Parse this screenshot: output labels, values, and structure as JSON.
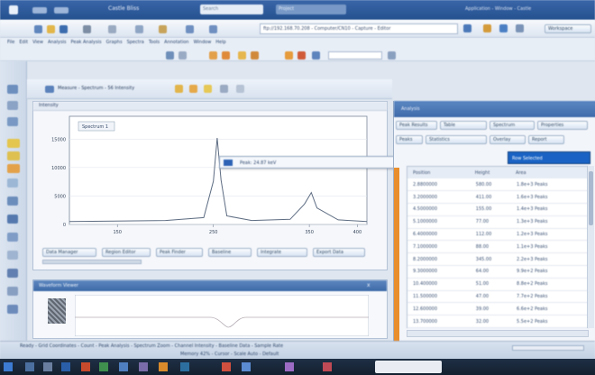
{
  "titlebar": {
    "title": "Castle Bliss",
    "search_placeholder": "Search",
    "extra": "Project",
    "right_text": "Application - Window - Castle"
  },
  "toolbar": {
    "address": "ftp://192.168.70.208 - Computer/CN10 - Capture - Editor",
    "right_button": "Workspace"
  },
  "menu": {
    "items": [
      "File",
      "Edit",
      "View",
      "Analysis",
      "Peak Analysis",
      "Graphs",
      "Spectra",
      "Tools",
      "Annotation",
      "Window",
      "Help"
    ]
  },
  "document": {
    "title": "Measure - Spectrum - 56 Intensity"
  },
  "plot": {
    "panel_title": "Intensity",
    "legend": "Spectrum 1",
    "popup_text": "Peak: 24.87 keV",
    "controls": [
      "Data Manager",
      "Region Editor",
      "Peak Finder",
      "Baseline",
      "Integrate",
      "Export Data"
    ]
  },
  "chart_data": {
    "type": "line",
    "x": [
      100,
      200,
      240,
      250,
      254,
      258,
      264,
      290,
      330,
      345,
      352,
      358,
      380,
      410
    ],
    "series": [
      {
        "values": [
          500,
          700,
          1200,
          7600,
          15200,
          7800,
          1500,
          700,
          900,
          3600,
          5600,
          2900,
          800,
          500
        ]
      }
    ],
    "xlim": [
      100,
      410
    ],
    "ylim": [
      0,
      19000
    ],
    "xticks": [
      150,
      250,
      350,
      400
    ],
    "yticks": [
      0,
      5000,
      10000,
      15000
    ],
    "ylabel": "",
    "xlabel": ""
  },
  "bottom_panel": {
    "title": "Waveform Viewer",
    "close": "x"
  },
  "right_panel": {
    "title": "Analysis",
    "tabs": [
      "Peak Results",
      "Table",
      "Spectrum",
      "Properties"
    ],
    "subtabs": [
      "Peaks",
      "Statistics",
      "Overlay",
      "Report"
    ],
    "selected": "Row Selected",
    "columns": [
      "Position",
      "Height",
      "Area"
    ],
    "rows": [
      [
        "2.8800000",
        "580.00",
        "1.8e+3 Peaks"
      ],
      [
        "3.2000000",
        "411.00",
        "1.6e+3 Peaks"
      ],
      [
        "4.5000000",
        "155.00",
        "1.4e+3 Peaks"
      ],
      [
        "5.1000000",
        "77.00",
        "1.3e+3 Peaks"
      ],
      [
        "6.4000000",
        "112.00",
        "1.2e+3 Peaks"
      ],
      [
        "7.1000000",
        "88.00",
        "1.1e+3 Peaks"
      ],
      [
        "8.2000000",
        "345.00",
        "2.2e+3 Peaks"
      ],
      [
        "9.3000000",
        "64.00",
        "9.9e+2 Peaks"
      ],
      [
        "10.400000",
        "51.00",
        "8.8e+2 Peaks"
      ],
      [
        "11.500000",
        "47.00",
        "7.7e+2 Peaks"
      ],
      [
        "12.600000",
        "39.00",
        "6.6e+2 Peaks"
      ],
      [
        "13.700000",
        "32.00",
        "5.5e+2 Peaks"
      ]
    ]
  },
  "statusbar": {
    "text": "Ready - Grid Coordinates - Count - Peak Analysis - Spectrum Zoom - Channel Intensity - Baseline Data - Sample Rate",
    "sub": "Memory 42% - Cursor - Scale Auto - Default"
  },
  "colors": {
    "accent": "#1a63c4",
    "panel_header": "#4e7bb9",
    "orange": "#e98e2c"
  }
}
